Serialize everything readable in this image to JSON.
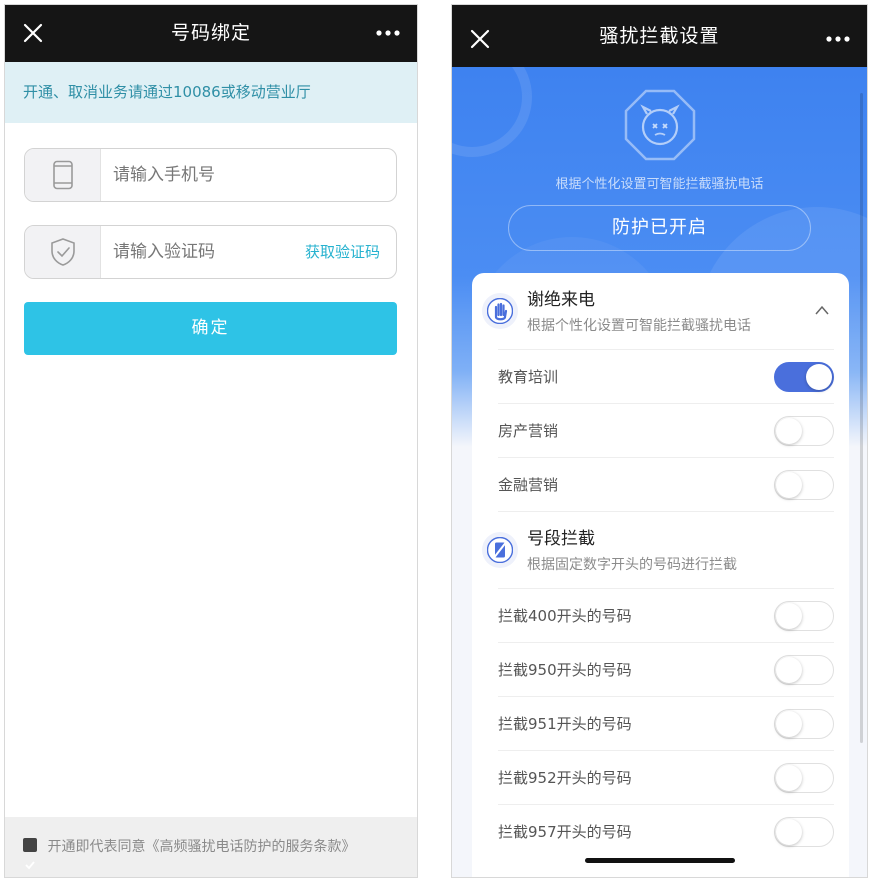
{
  "bind_screen": {
    "title": "号码绑定",
    "notice": "开通、取消业务请通过10086或移动营业厅",
    "phone_placeholder": "请输入手机号",
    "code_placeholder": "请输入验证码",
    "get_code_label": "获取验证码",
    "confirm_label": "确定",
    "agreement_text": "开通即代表同意《高频骚扰电话防护的服务条款》"
  },
  "settings_screen": {
    "title": "骚扰拦截设置",
    "hero_description": "根据个性化设置可智能拦截骚扰电话",
    "status_label": "防护已开启",
    "sections": [
      {
        "title": "谢绝来电",
        "subtitle": "根据个性化设置可智能拦截骚扰电话",
        "items": [
          {
            "label": "教育培训",
            "on": true
          },
          {
            "label": "房产营销",
            "on": false
          },
          {
            "label": "金融营销",
            "on": false
          }
        ]
      },
      {
        "title": "号段拦截",
        "subtitle": "根据固定数字开头的号码进行拦截",
        "items": [
          {
            "label": "拦截400开头的号码",
            "on": false
          },
          {
            "label": "拦截950开头的号码",
            "on": false
          },
          {
            "label": "拦截951开头的号码",
            "on": false
          },
          {
            "label": "拦截952开头的号码",
            "on": false
          },
          {
            "label": "拦截957开头的号码",
            "on": false
          }
        ]
      }
    ]
  },
  "colors": {
    "topbar": "#151515",
    "accent_cyan": "#2ec3e6",
    "link_cyan": "#26b2cf",
    "hero_blue": "#3e82f0",
    "toggle_on": "#4a6fdc"
  },
  "icons": [
    "close-icon",
    "more-icon",
    "phone-icon",
    "shield-icon",
    "bot-face-icon",
    "hand-icon",
    "phone-slash-icon",
    "chevron-up-icon",
    "checkbox-icon"
  ]
}
